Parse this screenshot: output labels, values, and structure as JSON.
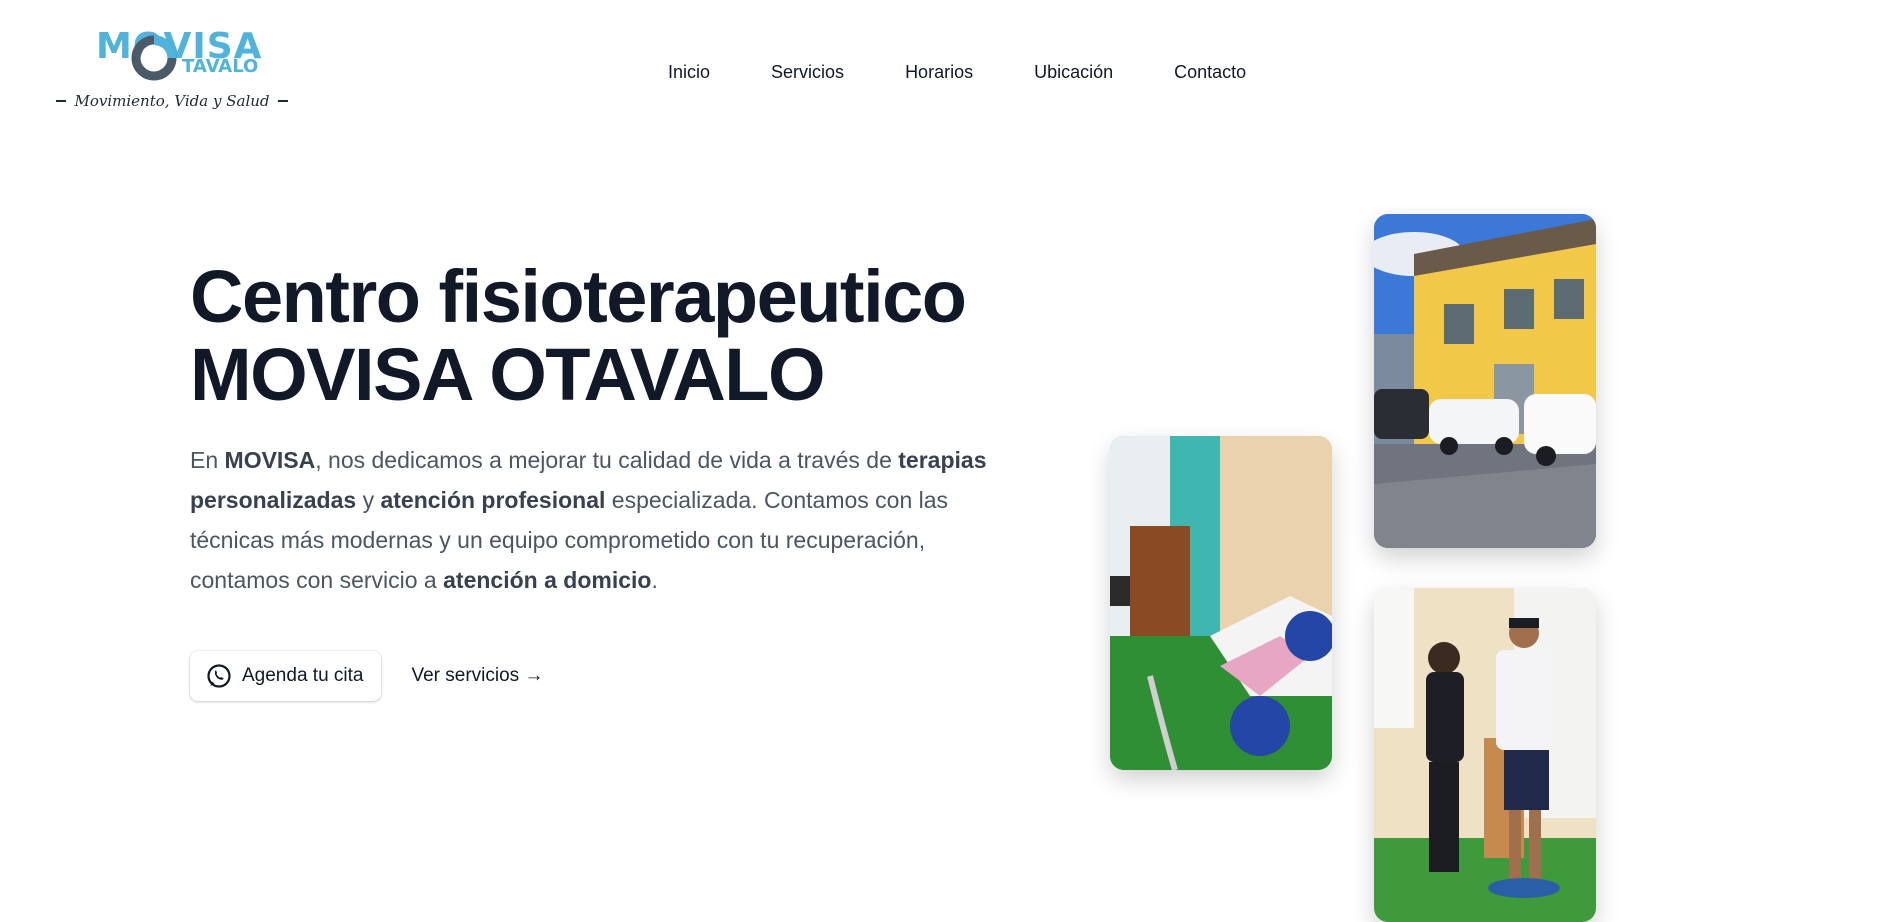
{
  "brand": {
    "logo_text_top": "MOVISA",
    "logo_text_bottom": "TAVALO",
    "tagline": "Movimiento, Vida y Salud",
    "accent_color": "#4fb3dc",
    "accent_dark": "#4a5a66"
  },
  "nav": {
    "items": [
      {
        "label": "Inicio"
      },
      {
        "label": "Servicios"
      },
      {
        "label": "Horarios"
      },
      {
        "label": "Ubicación"
      },
      {
        "label": "Contacto"
      }
    ]
  },
  "hero": {
    "title_line1": "Centro fisioterapeutico",
    "title_line2": "MOVISA OTAVALO",
    "desc": {
      "p1": "En ",
      "b1": "MOVISA",
      "p2": ", nos dedicamos a mejorar tu calidad de vida a través de ",
      "b2": "terapias personalizadas",
      "p3": " y ",
      "b3": "atención profesional",
      "p4": " especializada. Contamos con las técnicas más modernas y un equipo comprometido con tu recuperación, contamos con servicio a ",
      "b4": "atención a domicio",
      "p5": "."
    },
    "cta_primary": "Agenda tu cita",
    "cta_primary_icon": "whatsapp-icon",
    "cta_secondary": "Ver servicios →"
  },
  "photos": [
    {
      "subject": "building-exterior-photo"
    },
    {
      "subject": "therapy-room-photo"
    },
    {
      "subject": "therapist-patient-photo"
    }
  ]
}
